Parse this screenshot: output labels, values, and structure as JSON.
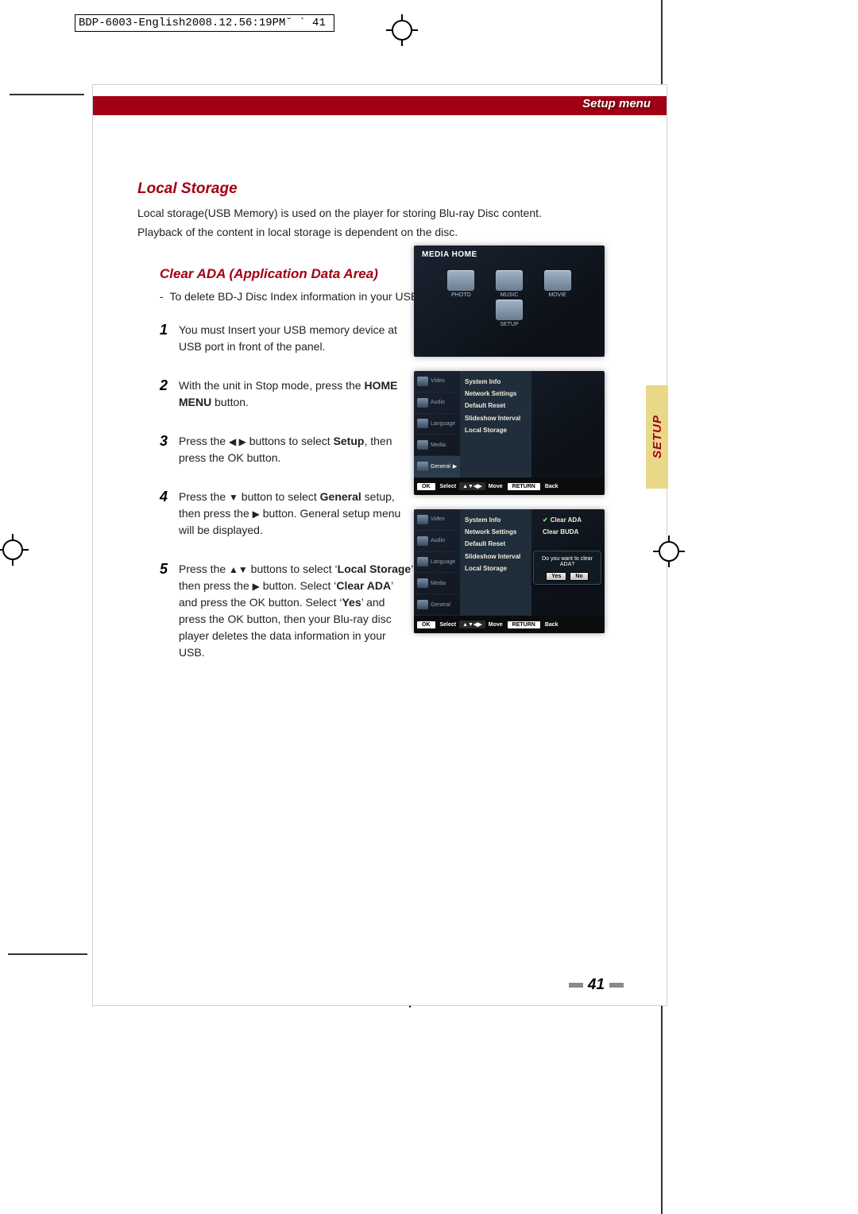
{
  "print_header": "BDP-6003-English2008.12.56:19PM˘  `   41",
  "breadcrumb": "Setup menu",
  "side_tab": "SETUP",
  "section_title": "Local Storage",
  "intro_line1": "Local storage(USB Memory) is used on the player for storing Blu-ray Disc content.",
  "intro_line2": "Playback of the content in local storage is dependent on the disc.",
  "sub_title": "Clear ADA (Application Data Area)",
  "bullet": "-  To delete BD-J Disc Index information in your USB",
  "steps": {
    "s1": {
      "num": "1",
      "txt_a": "You must Insert your USB memory device at USB port in front of the panel."
    },
    "s2": {
      "num": "2",
      "txt_a": "With the unit in Stop mode, press the ",
      "bold1": "HOME MENU",
      "txt_b": "  button."
    },
    "s3": {
      "num": "3",
      "txt_a": "Press the ",
      "icons": "◀ ▶",
      "txt_b": "  buttons to select ",
      "bold1": "Setup",
      "txt_c": ", then press the OK button."
    },
    "s4": {
      "num": "4",
      "txt_a": "Press the ",
      "icons": "▼",
      "txt_b": " button to select ",
      "bold1": "General",
      "txt_c": " setup, then press the ",
      "icons2": "▶",
      "txt_d": " button. General setup menu will be displayed."
    },
    "s5": {
      "num": "5",
      "txt_a": "Press the ",
      "icons": "▲▼",
      "txt_b": " buttons to select ‘",
      "bold1": "Local Storage",
      "txt_c": "’ then press the ",
      "icons2": "▶",
      "txt_d": " button. Select ‘",
      "bold2": "Clear ADA",
      "txt_e": "’ and press the OK button. Select ‘",
      "bold3": "Yes",
      "txt_f": "’ and press the OK button, then your Blu-ray disc player deletes the data information in your USB."
    }
  },
  "screenshot1": {
    "title": "MEDIA HOME",
    "cells": [
      "PHOTO",
      "MUSIC",
      "MOVIE",
      "SETUP"
    ]
  },
  "screenshot_sidebar": [
    "Video",
    "Audio",
    "Language",
    "Media",
    "General"
  ],
  "screenshot_general_opts": [
    "System Info",
    "Network Settings",
    "Default Reset",
    "Slideshow Interval",
    "Local Storage"
  ],
  "screenshot_right_opts": [
    "Clear ADA",
    "Clear BUDA"
  ],
  "dialog_msg": "Do you want to clear ADA?",
  "dialog_yes": "Yes",
  "dialog_no": "No",
  "footer": {
    "ok": "OK",
    "select": "Select",
    "move_icons": "▲▼◀▶",
    "move": "Move",
    "return": "RETURN",
    "back": "Back"
  },
  "page_number": "41"
}
